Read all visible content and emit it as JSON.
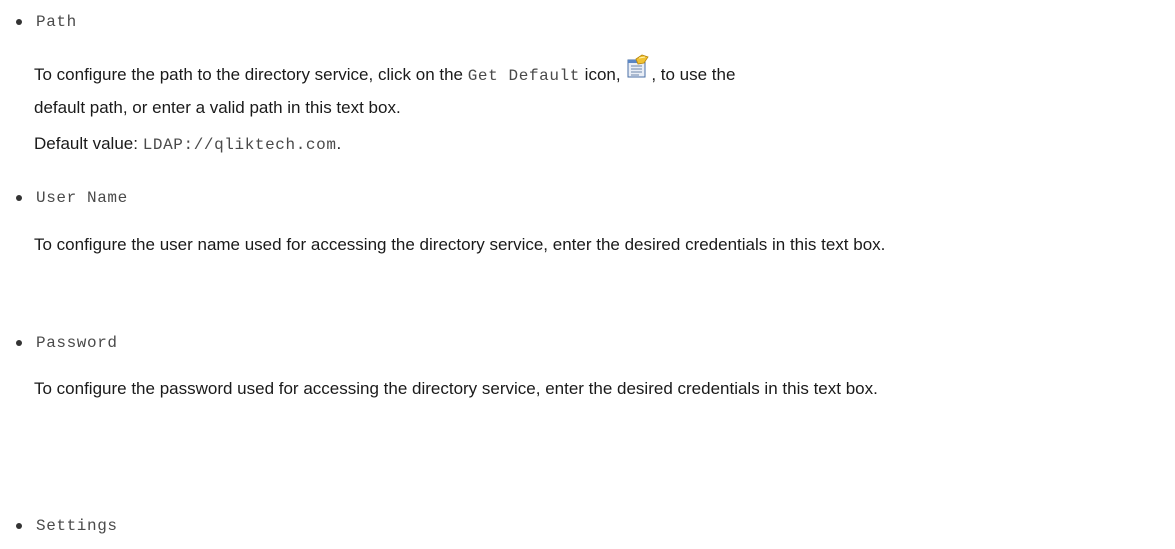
{
  "sections": [
    {
      "term": "Path",
      "description": {
        "before_code": "To configure the path to the directory service, click on the ",
        "code": "Get Default",
        "after_code": " icon,",
        "after_icon": ", to use the default path, or enter a valid path in this text box.",
        "icon": "get-default-icon"
      },
      "default": {
        "label": "Default value:",
        "value": "LDAP://qliktech.com",
        "suffix": "."
      }
    },
    {
      "term": "User Name",
      "description": "To configure the user name used for accessing the directory service, enter the desired credentials in this text box."
    },
    {
      "term": "Password",
      "description": "To configure the password used for accessing the directory service, enter the desired credentials in this text box."
    },
    {
      "term": "Settings"
    }
  ],
  "colors": {
    "text": "#1a1a1a",
    "code": "#4a4a4a",
    "bullet": "#333333"
  }
}
